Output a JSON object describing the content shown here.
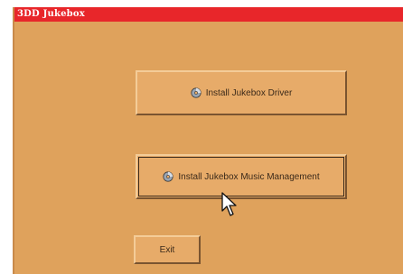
{
  "window": {
    "title": "3DD Jukebox"
  },
  "buttons": {
    "install_driver": "Install Jukebox Driver",
    "install_music": "Install Jukebox Music Management",
    "exit": "Exit"
  },
  "icons": {
    "button_icon": "cd-disc-icon",
    "cursor": "arrow-cursor-icon"
  },
  "colors": {
    "background": "#dfa25c",
    "title_bar": "#e8262a",
    "button_face": "#e7ab69"
  }
}
